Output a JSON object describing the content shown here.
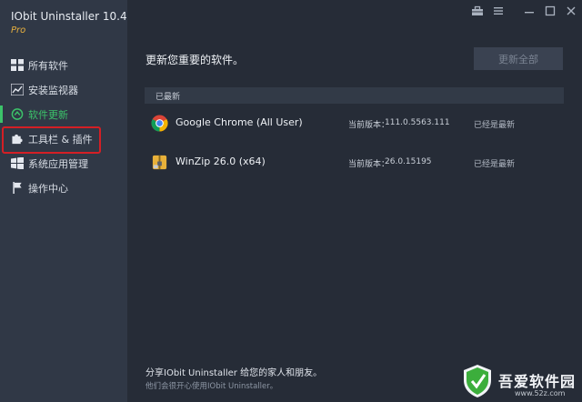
{
  "app": {
    "title": "IObit Uninstaller 10.4",
    "edition": "Pro"
  },
  "sidebar": {
    "items": [
      {
        "label": "所有软件",
        "icon": "grid-icon"
      },
      {
        "label": "安装监视器",
        "icon": "chart-icon"
      },
      {
        "label": "软件更新",
        "icon": "update-icon",
        "active": true
      },
      {
        "label": "工具栏 & 插件",
        "icon": "puzzle-icon"
      },
      {
        "label": "系统应用管理",
        "icon": "windows-icon"
      },
      {
        "label": "操作中心",
        "icon": "flag-icon"
      }
    ]
  },
  "main": {
    "headline": "更新您重要的软件。",
    "update_all_label": "更新全部",
    "section_label": "已最新",
    "apps": [
      {
        "name": "Google Chrome (All User)",
        "version_label": "当前版本：",
        "version": "111.0.5563.111",
        "status": "已经是最新",
        "icon": "chrome-icon"
      },
      {
        "name": "WinZip 26.0 (x64)",
        "version_label": "当前版本：",
        "version": "26.0.15195",
        "status": "已经是最新",
        "icon": "winzip-icon"
      }
    ],
    "share_text": "分享IObit Uninstaller 给您的家人和朋友。",
    "share_subtext": "他们会很开心使用IObit Uninstaller。"
  },
  "watermark": {
    "text": "吾爱软件园",
    "url": "www.52z.com"
  },
  "colors": {
    "accent": "#3cc36a",
    "highlight": "#d41f25",
    "sidebar": "#303846",
    "background": "#262c37"
  }
}
